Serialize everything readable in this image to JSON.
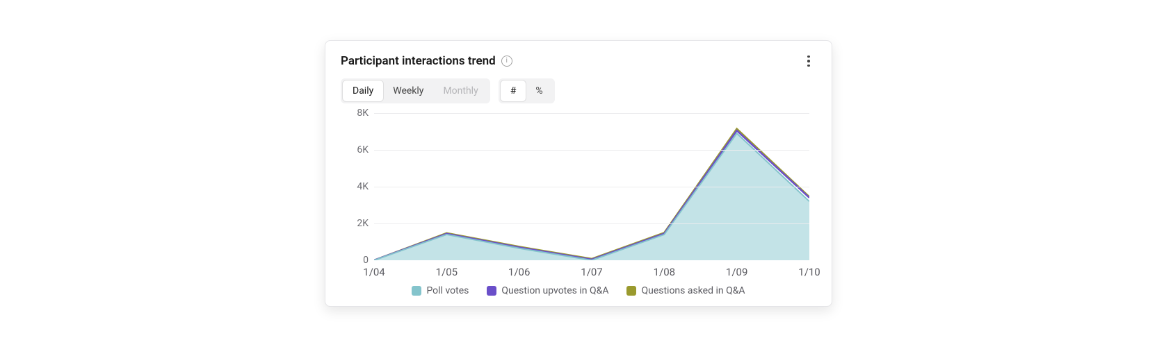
{
  "card": {
    "title": "Participant interactions trend"
  },
  "toggles": {
    "period": [
      {
        "label": "Daily",
        "state": "active"
      },
      {
        "label": "Weekly",
        "state": "normal"
      },
      {
        "label": "Monthly",
        "state": "disabled"
      }
    ],
    "unit": [
      {
        "label": "#",
        "state": "active"
      },
      {
        "label": "%",
        "state": "normal"
      }
    ]
  },
  "chart_data": {
    "type": "area",
    "categories": [
      "1/04",
      "1/05",
      "1/06",
      "1/07",
      "1/08",
      "1/09",
      "1/10"
    ],
    "series": [
      {
        "name": "Poll votes",
        "color": "#84c4cc",
        "fill": "#b9dee3",
        "values": [
          0,
          1400,
          650,
          0,
          1400,
          6900,
          3200
        ]
      },
      {
        "name": "Question upvotes in Q&A",
        "color": "#6a4fc9",
        "fill": "#6a4fc9",
        "values": [
          0,
          1440,
          700,
          40,
          1450,
          7050,
          3400
        ]
      },
      {
        "name": "Questions asked in Q&A",
        "color": "#9a9a2e",
        "fill": "#9a9a2e",
        "values": [
          0,
          1480,
          740,
          80,
          1500,
          7150,
          3450
        ]
      }
    ],
    "title": "Participant interactions trend",
    "xlabel": "",
    "ylabel": "",
    "y_ticks": [
      0,
      2000,
      4000,
      6000,
      8000
    ],
    "y_tick_labels": [
      "0",
      "2K",
      "4K",
      "6K",
      "8K"
    ],
    "ylim": [
      0,
      8000
    ]
  }
}
